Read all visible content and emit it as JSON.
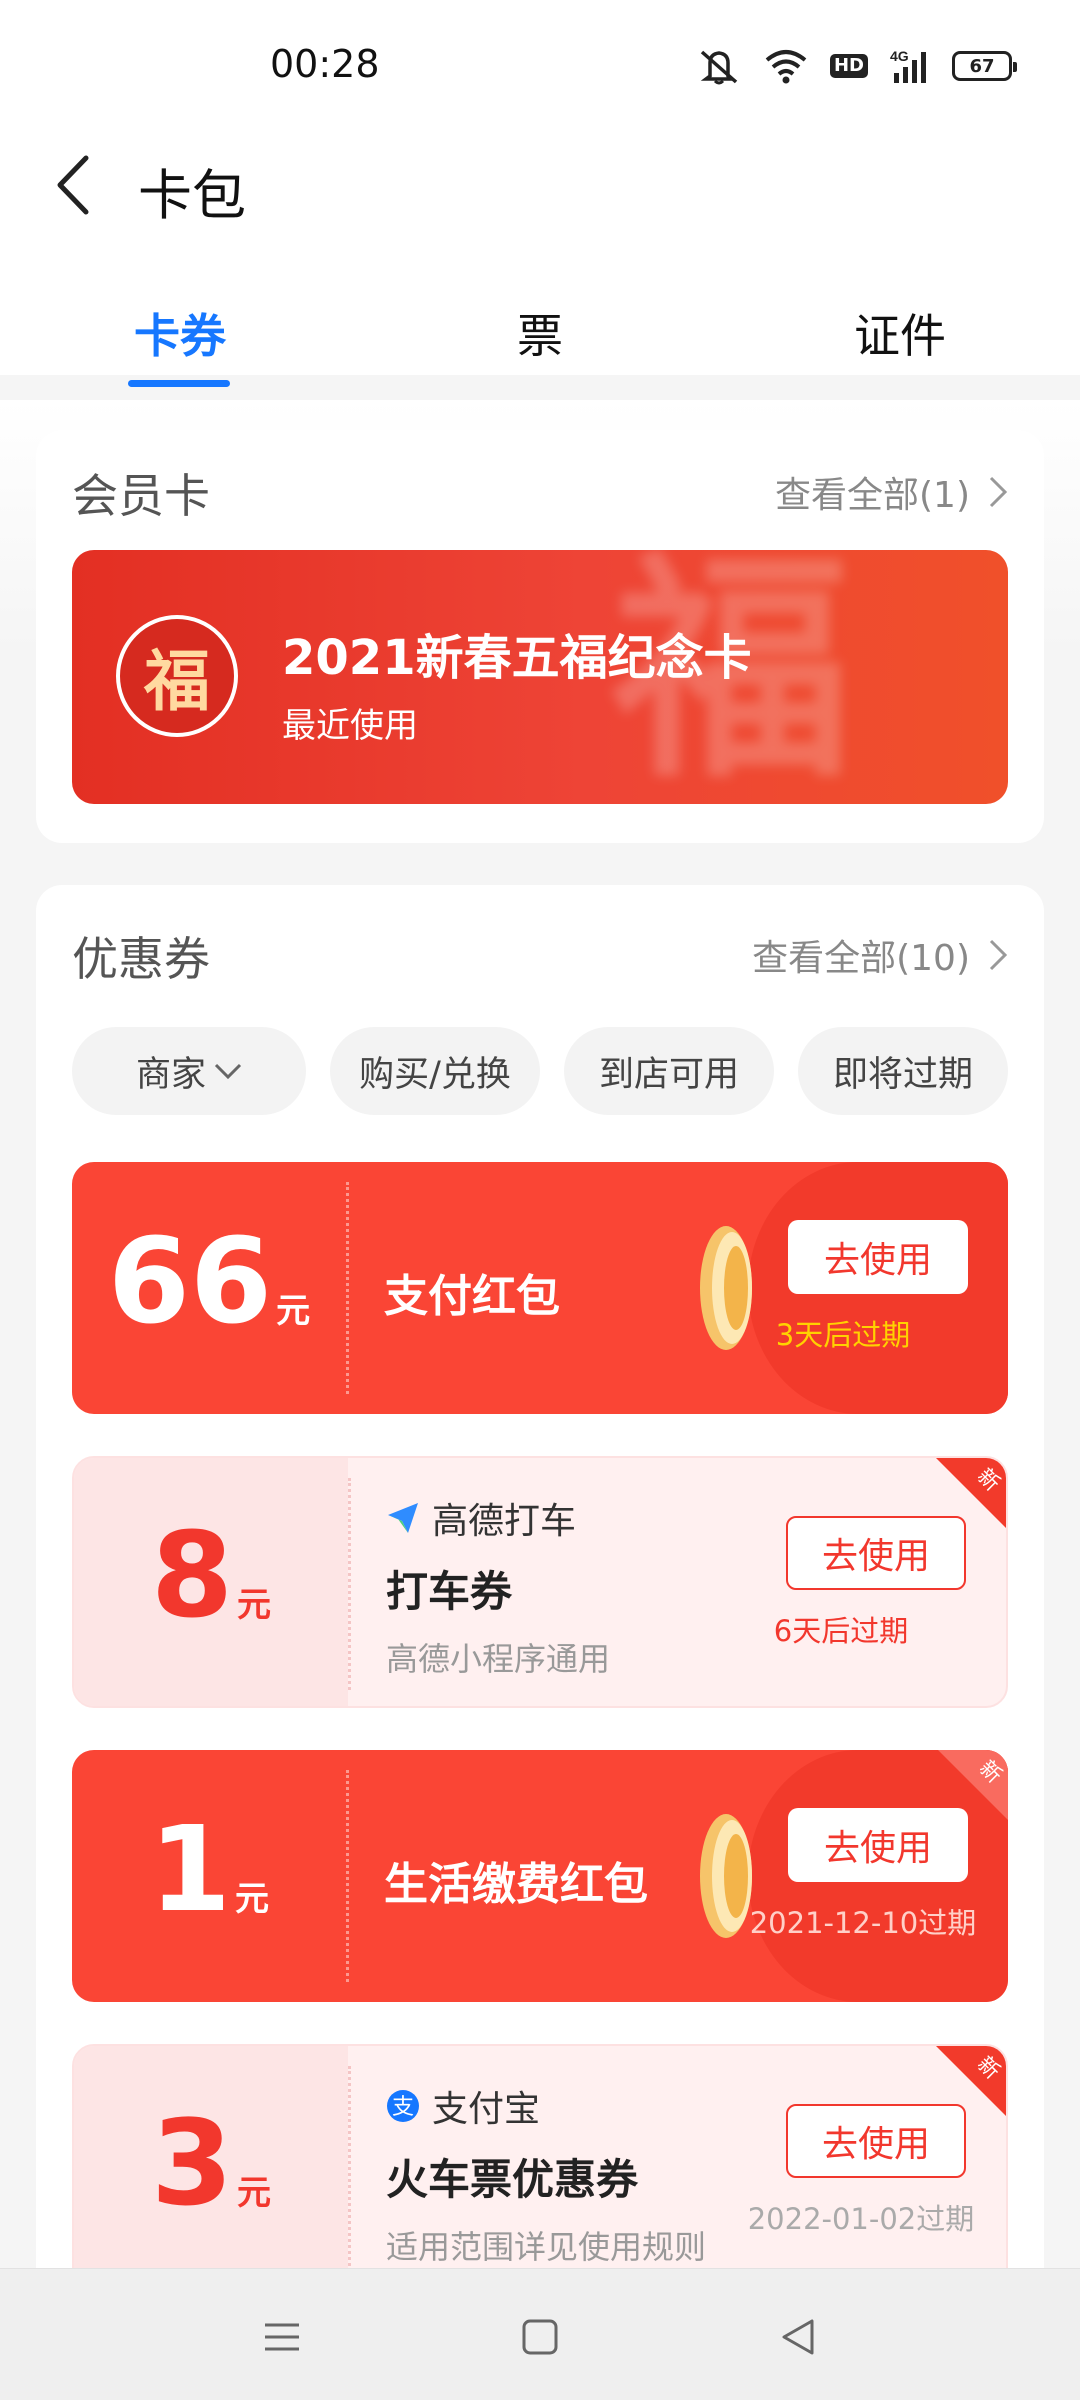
{
  "status_bar": {
    "time": "00:28",
    "battery": "67",
    "hd": "HD",
    "network": "4G"
  },
  "header": {
    "title": "卡包"
  },
  "tabs": [
    {
      "label": "卡券",
      "active": true
    },
    {
      "label": "票",
      "active": false
    },
    {
      "label": "证件",
      "active": false
    }
  ],
  "member_section": {
    "title": "会员卡",
    "view_all": "查看全部(1)",
    "card": {
      "logo_char": "福",
      "name": "2021新春五福纪念卡",
      "subtitle": "最近使用"
    }
  },
  "coupon_section": {
    "title": "优惠券",
    "view_all": "查看全部(10)",
    "filters": [
      "商家",
      "购买/兑换",
      "到店可用",
      "即将过期"
    ],
    "coupons": [
      {
        "amount": "66",
        "unit": "元",
        "title": "支付红包",
        "button": "去使用",
        "expire": "3天后过期",
        "style": "red",
        "is_new": false
      },
      {
        "amount": "8",
        "unit": "元",
        "brand": "高德打车",
        "title": "打车券",
        "desc": "高德小程序通用",
        "button": "去使用",
        "expire": "6天后过期",
        "style": "pink",
        "is_new": true
      },
      {
        "amount": "1",
        "unit": "元",
        "title": "生活缴费红包",
        "button": "去使用",
        "expire": "2021-12-10过期",
        "style": "red",
        "is_new": true
      },
      {
        "amount": "3",
        "unit": "元",
        "brand": "支付宝",
        "title": "火车票优惠券",
        "desc": "适用范围详见使用规则",
        "button": "去使用",
        "expire": "2022-01-02过期",
        "style": "pink",
        "is_new": true
      }
    ],
    "new_tag": "新"
  },
  "colors": {
    "accent": "#1677ff",
    "coupon_red": "#fa4535",
    "coupon_pink": "#fff0f0",
    "expire_gold": "#ffd200",
    "expire_red": "#f2372d"
  }
}
